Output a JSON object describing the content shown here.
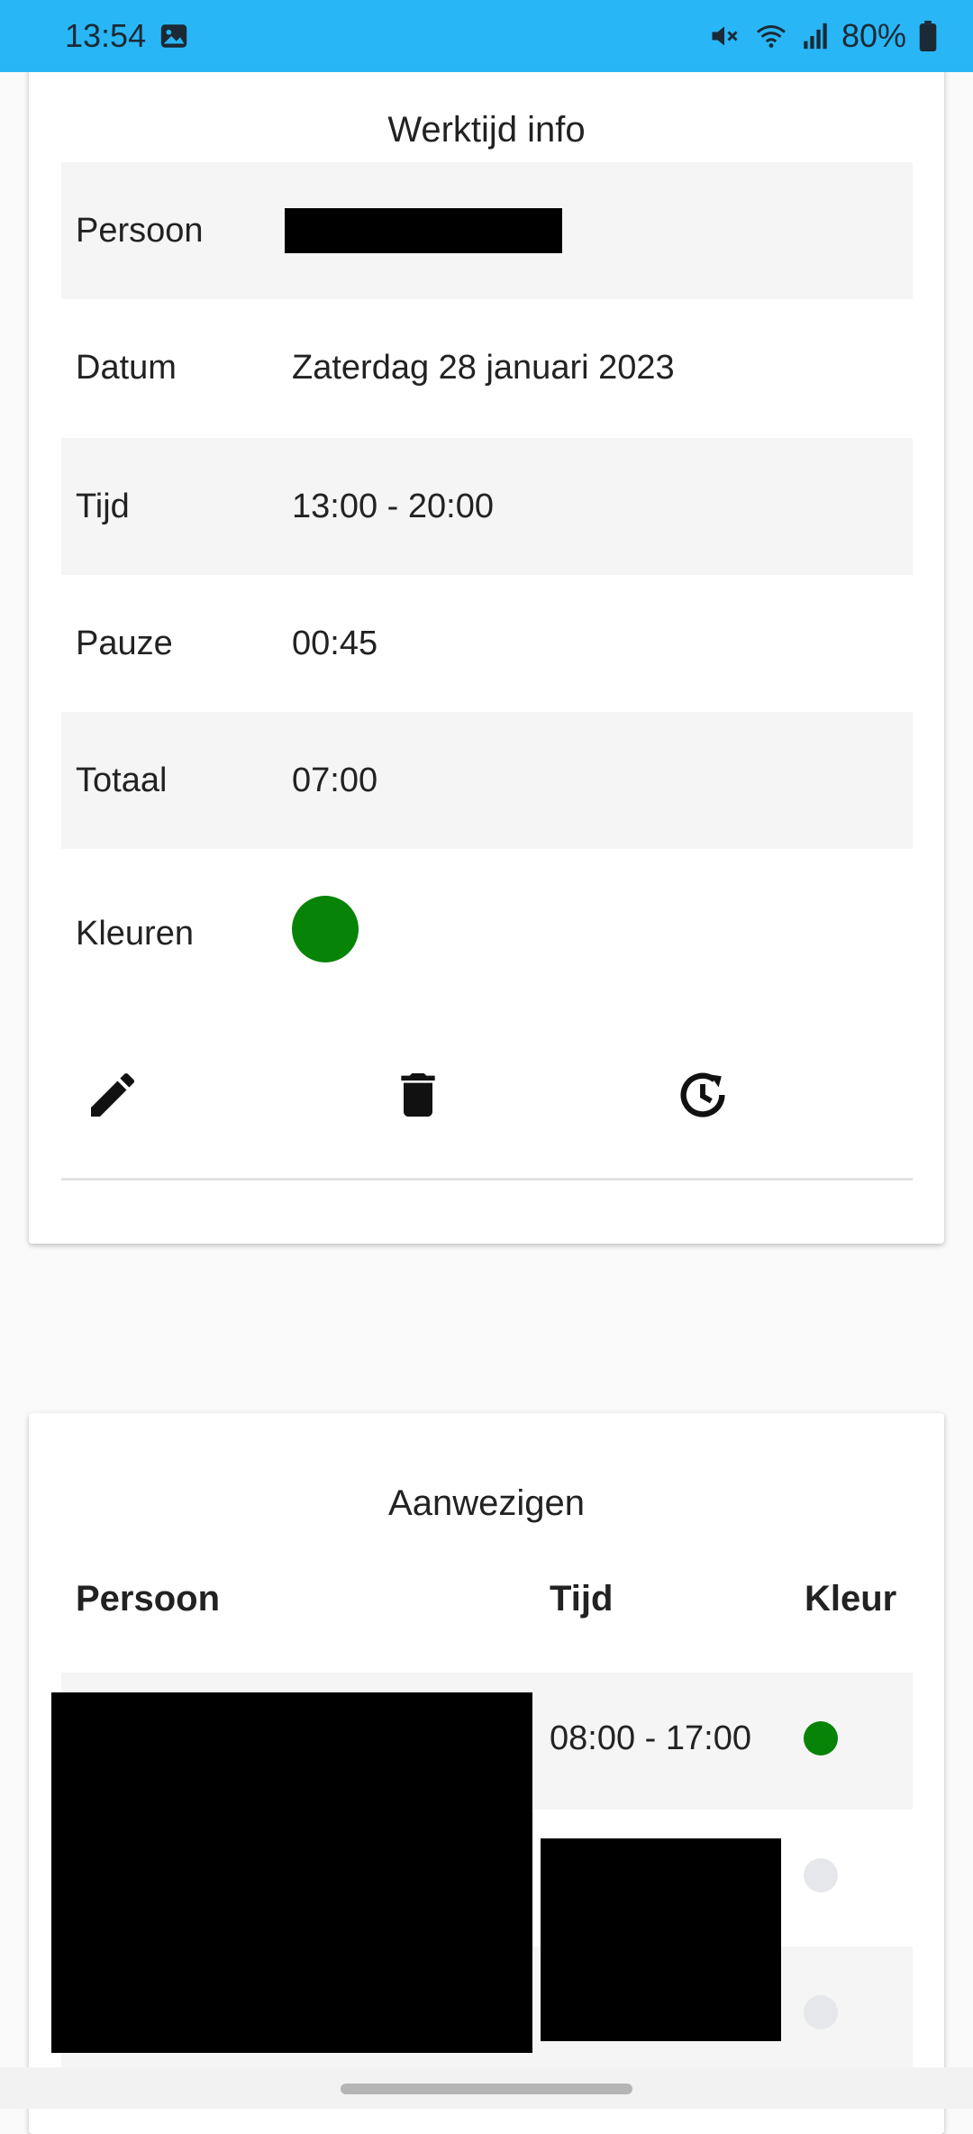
{
  "status_bar": {
    "time": "13:54",
    "battery": "80%",
    "icons": [
      "image-icon",
      "mute-icon",
      "wifi-icon",
      "signal-icon",
      "battery-icon"
    ]
  },
  "work_info": {
    "title": "Werktijd info",
    "rows": [
      {
        "label": "Persoon",
        "value": ""
      },
      {
        "label": "Datum",
        "value": "Zaterdag 28 januari 2023"
      },
      {
        "label": "Tijd",
        "value": "13:00 - 20:00"
      },
      {
        "label": "Pauze",
        "value": "00:45"
      },
      {
        "label": "Totaal",
        "value": "07:00"
      },
      {
        "label": "Kleuren",
        "value": ""
      }
    ],
    "color": "#078307",
    "actions": [
      "edit-icon",
      "delete-icon",
      "history-icon"
    ]
  },
  "attendance": {
    "title": "Aanwezigen",
    "headers": {
      "person": "Persoon",
      "time": "Tijd",
      "color": "Kleur"
    },
    "rows": [
      {
        "time": "08:00 - 17:00",
        "color": "#078307"
      },
      {
        "time": "",
        "color": "#e5e7ea"
      },
      {
        "time": "",
        "color": "#e5e7ea"
      }
    ]
  }
}
